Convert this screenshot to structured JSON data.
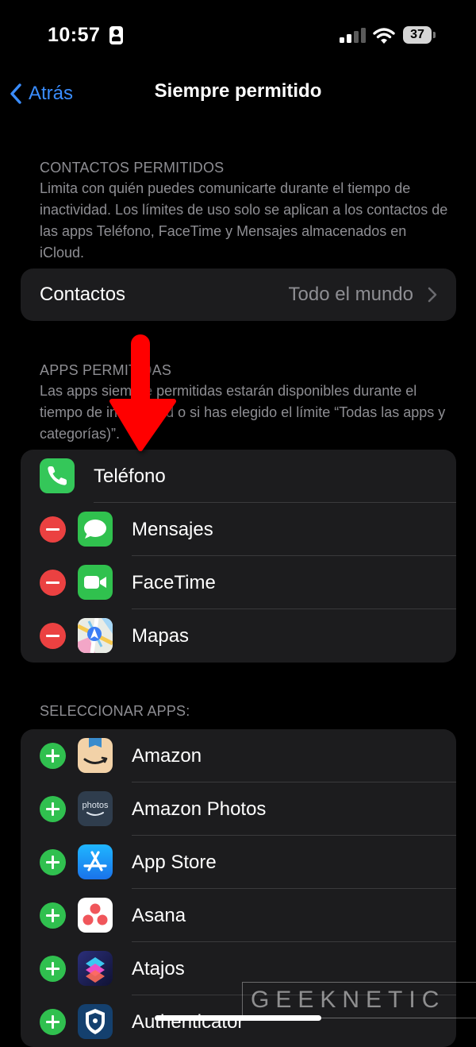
{
  "status_bar": {
    "time": "10:57",
    "battery": "37"
  },
  "nav": {
    "back_label": "Atrás",
    "title": "Siempre permitido"
  },
  "contacts_section": {
    "header": "CONTACTOS PERMITIDOS",
    "description": "Limita con quién puedes comunicarte durante el tiempo de inactividad. Los límites de uso solo se aplican a los contactos de las apps Teléfono, FaceTime y Mensajes almacenados en iCloud.",
    "row_label": "Contactos",
    "row_value": "Todo el mundo"
  },
  "allowed_section": {
    "header": "APPS PERMITIDAS",
    "description": "Las apps siempre permitidas estarán disponibles durante el tiempo de inactividad o si has elegido el límite “Todas las apps y categorías)”.",
    "apps": [
      {
        "label": "Teléfono",
        "icon": "phone-icon"
      },
      {
        "label": "Mensajes",
        "icon": "messages-icon"
      },
      {
        "label": "FaceTime",
        "icon": "facetime-icon"
      },
      {
        "label": "Mapas",
        "icon": "maps-icon"
      }
    ]
  },
  "select_section": {
    "header": "SELECCIONAR APPS:",
    "apps": [
      {
        "label": "Amazon",
        "icon": "amazon-icon"
      },
      {
        "label": "Amazon Photos",
        "icon": "amazon-photos-icon",
        "icon_text": "photos"
      },
      {
        "label": "App Store",
        "icon": "app-store-icon"
      },
      {
        "label": "Asana",
        "icon": "asana-icon"
      },
      {
        "label": "Atajos",
        "icon": "shortcuts-icon"
      },
      {
        "label": "Authenticator",
        "icon": "authenticator-icon"
      }
    ]
  },
  "watermark": "GEEKNETIC",
  "colors": {
    "accent": "#3a8dff",
    "remove": "#eb4141",
    "add": "#30c04f",
    "card": "#1c1c1e",
    "arrow": "#ff0000"
  }
}
